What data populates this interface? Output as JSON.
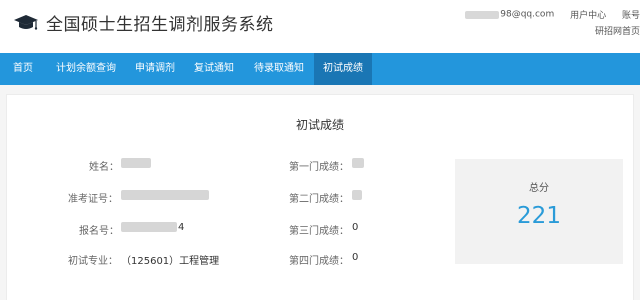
{
  "header": {
    "title": "全国硕士生招生调剂服务系统",
    "user_email": "98@qq.com",
    "user_center": "用户中心",
    "account": "账号",
    "yanzhao_home": "研招网首页"
  },
  "nav": {
    "items": [
      {
        "label": "首页"
      },
      {
        "label": "计划余额查询"
      },
      {
        "label": "申请调剂"
      },
      {
        "label": "复试通知"
      },
      {
        "label": "待录取通知"
      },
      {
        "label": "初试成绩"
      }
    ],
    "active_index": 5
  },
  "panel": {
    "title": "初试成绩",
    "left_fields": [
      {
        "label": "姓名：",
        "value": ""
      },
      {
        "label": "准考证号：",
        "value": ""
      },
      {
        "label": "报名号：",
        "value": "4"
      },
      {
        "label": "初试专业：",
        "value": "（125601）工程管理"
      }
    ],
    "right_fields": [
      {
        "label": "第一门成绩：",
        "value": ""
      },
      {
        "label": "第二门成绩：",
        "value": ""
      },
      {
        "label": "第三门成绩：",
        "value": "0"
      },
      {
        "label": "第四门成绩：",
        "value": "0"
      }
    ],
    "total_label": "总分",
    "total_value": "221"
  },
  "colors": {
    "nav_bg": "#2396dc",
    "nav_active_bg": "#1a76b4",
    "total_value": "#2a9bd8",
    "total_box_bg": "#f2f2f2"
  },
  "icons": {
    "logo": "graduation-cap-icon"
  }
}
